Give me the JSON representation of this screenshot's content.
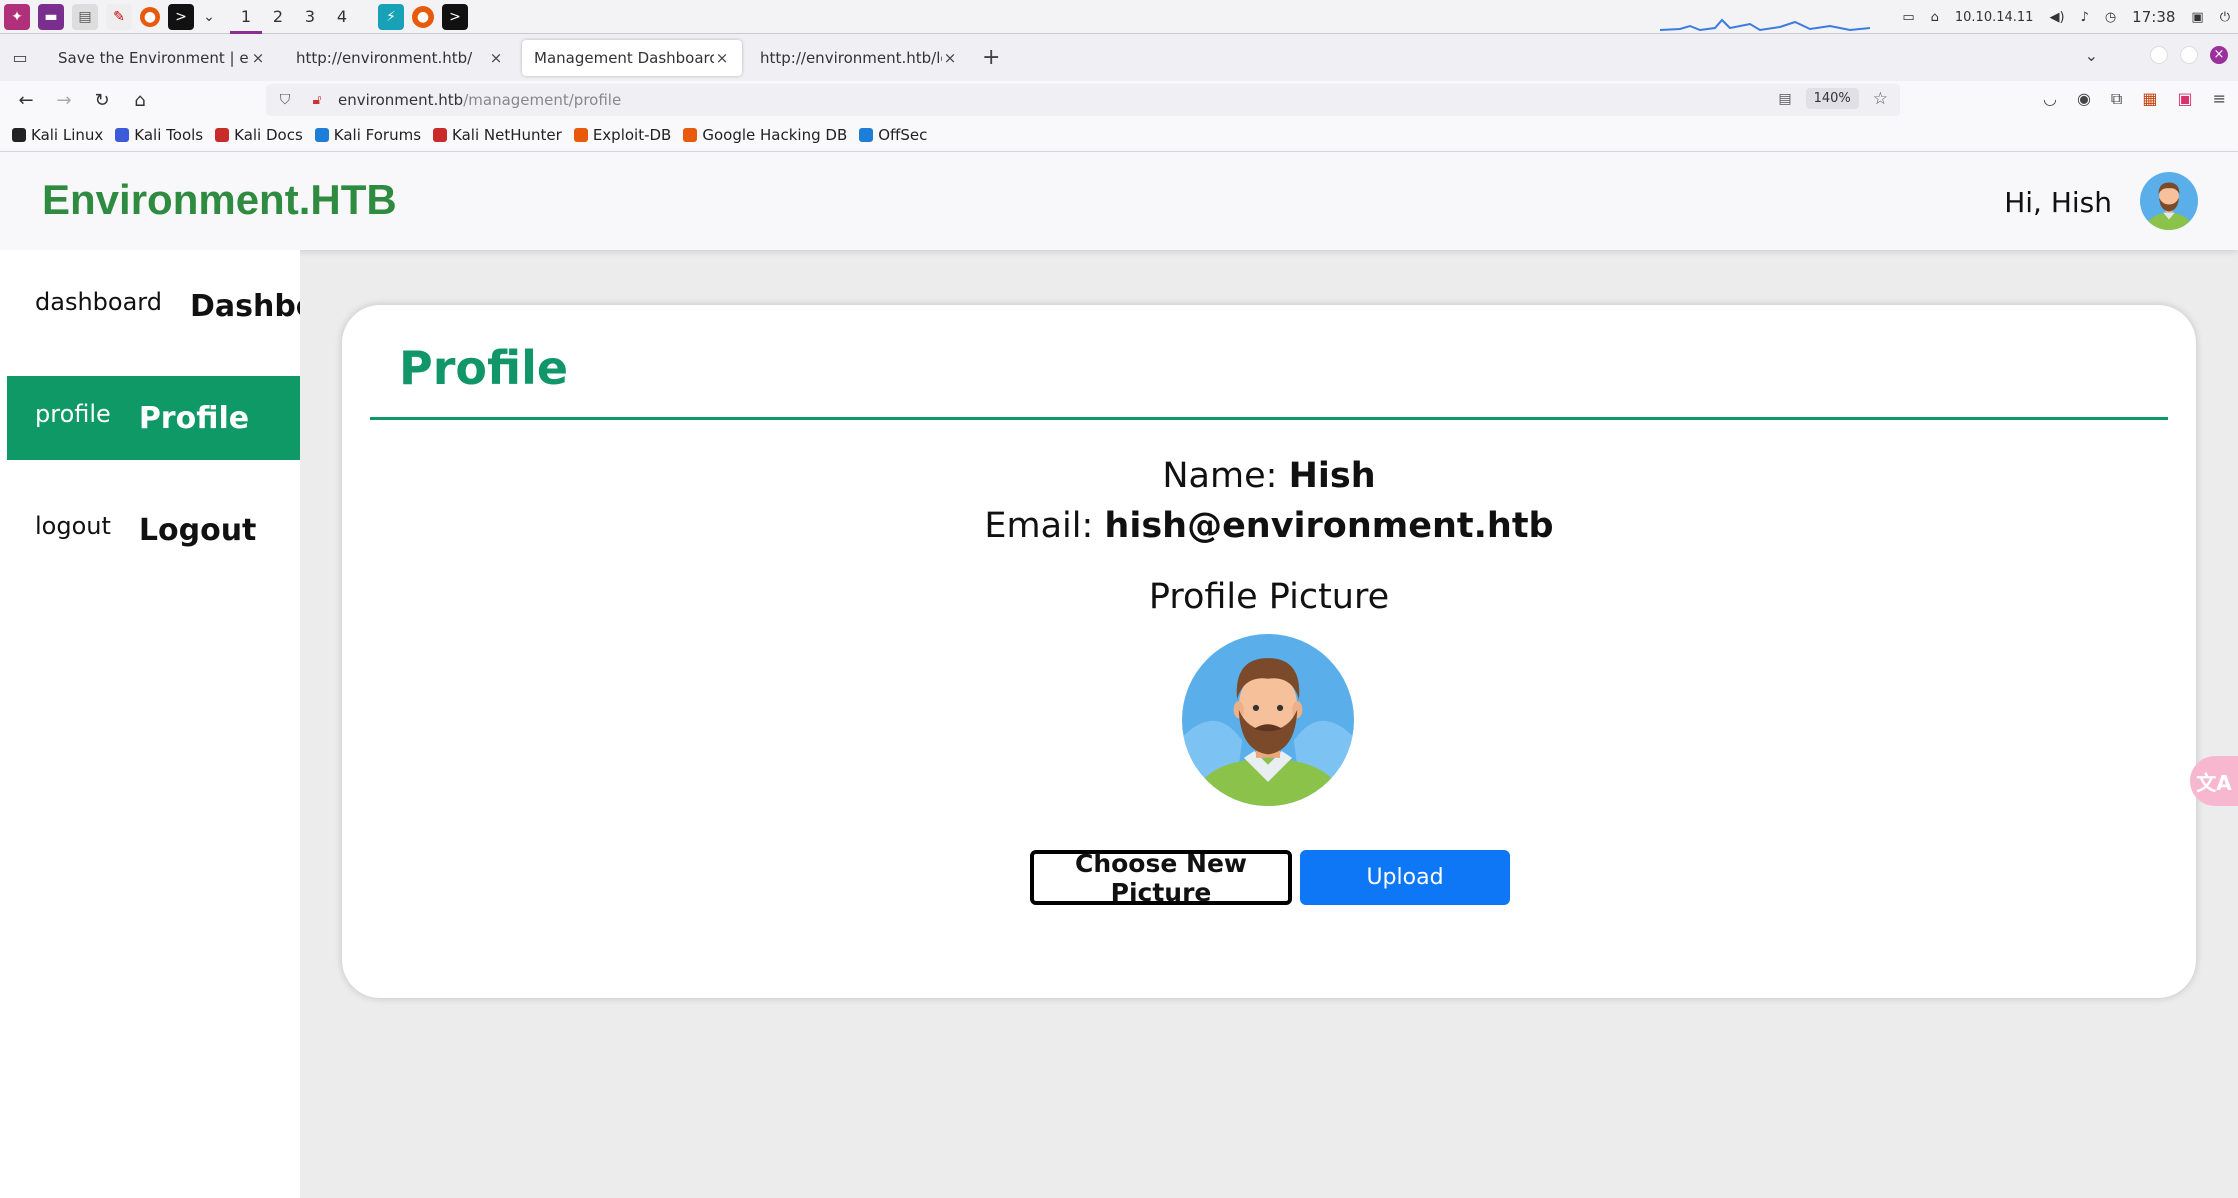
{
  "taskbar": {
    "workspaces": [
      "1",
      "2",
      "3",
      "4"
    ],
    "ip": "10.10.14.11",
    "time": "17:38"
  },
  "tabs": [
    {
      "title": "Save the Environment | envir",
      "active": false
    },
    {
      "title": "http://environment.htb/",
      "active": false
    },
    {
      "title": "Management Dashboard | en",
      "active": true
    },
    {
      "title": "http://environment.htb/login",
      "active": false
    }
  ],
  "url": {
    "host": "environment.htb",
    "path": "/management/profile",
    "zoom": "140%"
  },
  "bookmarks": [
    {
      "label": "Kali Linux",
      "color": "#222222"
    },
    {
      "label": "Kali Tools",
      "color": "#3b5bdb"
    },
    {
      "label": "Kali Docs",
      "color": "#c92a2a"
    },
    {
      "label": "Kali Forums",
      "color": "#1c7ed6"
    },
    {
      "label": "Kali NetHunter",
      "color": "#c92a2a"
    },
    {
      "label": "Exploit-DB",
      "color": "#e8590c"
    },
    {
      "label": "Google Hacking DB",
      "color": "#e8590c"
    },
    {
      "label": "OffSec",
      "color": "#1c7ed6"
    }
  ],
  "site": {
    "title": "Environment.HTB",
    "greeting": "Hi, Hish"
  },
  "sidebar": {
    "items": [
      {
        "alt": "dashboard",
        "label": "Dashboard",
        "active": false
      },
      {
        "alt": "profile",
        "label": "Profile",
        "active": true
      },
      {
        "alt": "logout",
        "label": "Logout",
        "active": false
      }
    ]
  },
  "profile": {
    "heading": "Profile",
    "name_label": "Name:",
    "name_value": "Hish",
    "email_label": "Email:",
    "email_value": "hish@environment.htb",
    "picture_caption": "Profile Picture",
    "choose_label": "Choose New Picture",
    "upload_label": "Upload"
  },
  "colors": {
    "brand_green": "#2e8b40",
    "accent_green": "#11966a",
    "upload_blue": "#0d77f5"
  }
}
